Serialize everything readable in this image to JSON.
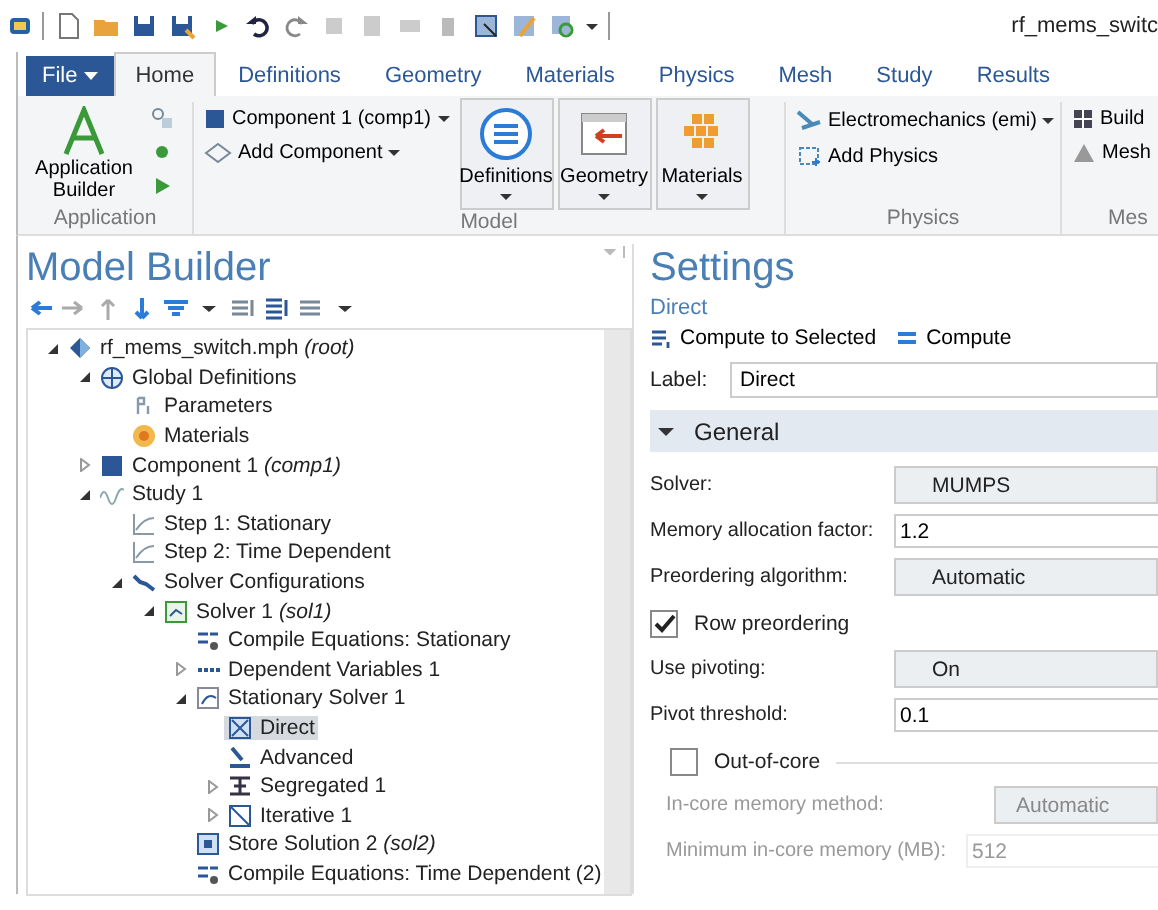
{
  "title": "rf_mems_switc",
  "file_menu": "File",
  "ribbon_tabs": [
    {
      "label": "Home",
      "kind": "tab",
      "selected": true
    },
    {
      "label": "Definitions",
      "kind": "tab",
      "selected": false
    },
    {
      "label": "Geometry",
      "kind": "tab",
      "selected": false
    },
    {
      "label": "Materials",
      "kind": "tab",
      "selected": false
    },
    {
      "label": "Physics",
      "kind": "tab",
      "selected": false
    },
    {
      "label": "Mesh",
      "kind": "tab",
      "selected": false
    },
    {
      "label": "Study",
      "kind": "tab",
      "selected": false
    },
    {
      "label": "Results",
      "kind": "tab",
      "selected": false
    }
  ],
  "ribbon": {
    "application": {
      "label": "Application",
      "button": "Application Builder"
    },
    "model": {
      "label": "Model",
      "component": "Component 1 (comp1)",
      "add_component": "Add Component",
      "big": [
        "Definitions",
        "Geometry",
        "Materials"
      ]
    },
    "physics": {
      "label": "Physics",
      "interface": "Electromechanics (emi)",
      "add_physics": "Add Physics"
    },
    "mesh": {
      "label": "Mes",
      "build": "Build",
      "mesh": "Mesh"
    }
  },
  "model_builder": {
    "title": "Model Builder",
    "tree": [
      {
        "label": "rf_mems_switch.mph *(root)*",
        "kind": "model",
        "expanded": true,
        "selected": false,
        "children": [
          {
            "label": "Global Definitions",
            "kind": "globe",
            "expanded": true,
            "selected": false,
            "children": [
              {
                "label": "Parameters",
                "kind": "param",
                "selected": false
              },
              {
                "label": "Materials",
                "kind": "material",
                "selected": false
              }
            ]
          },
          {
            "label": "Component 1 *(comp1)*",
            "kind": "component",
            "expanded": false,
            "selected": false
          },
          {
            "label": "Study 1",
            "kind": "study",
            "expanded": true,
            "selected": false,
            "children": [
              {
                "label": "Step 1: Stationary",
                "kind": "step",
                "selected": false
              },
              {
                "label": "Step 2: Time Dependent",
                "kind": "step",
                "selected": false
              },
              {
                "label": "Solver Configurations",
                "kind": "solver",
                "expanded": true,
                "selected": false,
                "children": [
                  {
                    "label": "Solver 1 *(sol1)*",
                    "kind": "sol",
                    "expanded": true,
                    "selected": false,
                    "children": [
                      {
                        "label": "Compile Equations: Stationary",
                        "kind": "compile",
                        "selected": false
                      },
                      {
                        "label": "Dependent Variables 1",
                        "kind": "vars",
                        "expanded": false,
                        "selected": false
                      },
                      {
                        "label": "Stationary Solver 1",
                        "kind": "stat",
                        "expanded": true,
                        "selected": false,
                        "children": [
                          {
                            "label": "Direct",
                            "kind": "direct",
                            "selected": true
                          },
                          {
                            "label": "Advanced",
                            "kind": "adv",
                            "selected": false
                          },
                          {
                            "label": "Segregated 1",
                            "kind": "seg",
                            "expanded": false,
                            "selected": false
                          },
                          {
                            "label": "Iterative 1",
                            "kind": "iter",
                            "expanded": false,
                            "selected": false
                          }
                        ]
                      },
                      {
                        "label": "Store Solution 2 *(sol2)*",
                        "kind": "store",
                        "selected": false
                      },
                      {
                        "label": "Compile Equations: Time Dependent (2)",
                        "kind": "compile",
                        "selected": false
                      }
                    ]
                  }
                ]
              }
            ]
          }
        ]
      }
    ]
  },
  "settings": {
    "title": "Settings",
    "subtitle": "Direct",
    "toolbar": [
      "Compute to Selected",
      "Compute"
    ],
    "label_caption": "Label:",
    "label_value": "Direct",
    "section": {
      "title": "General",
      "expanded": true
    },
    "rows": [
      {
        "kind": "select",
        "label": "Solver:",
        "value": "MUMPS"
      },
      {
        "kind": "input",
        "label": "Memory allocation factor:",
        "value": "1.2"
      },
      {
        "kind": "select",
        "label": "Preordering algorithm:",
        "value": "Automatic"
      },
      {
        "kind": "checkbox",
        "label": "Row preordering",
        "checked": true
      },
      {
        "kind": "select",
        "label": "Use pivoting:",
        "value": "On"
      },
      {
        "kind": "input",
        "label": "Pivot threshold:",
        "value": "0.1"
      }
    ],
    "group": {
      "title": "Out-of-core",
      "checked": false,
      "rows": [
        {
          "kind": "select",
          "label": "In-core memory method:",
          "value": "Automatic",
          "disabled": true
        },
        {
          "kind": "input",
          "label": "Minimum in-core memory (MB):",
          "value": "512",
          "disabled": true
        }
      ]
    }
  }
}
